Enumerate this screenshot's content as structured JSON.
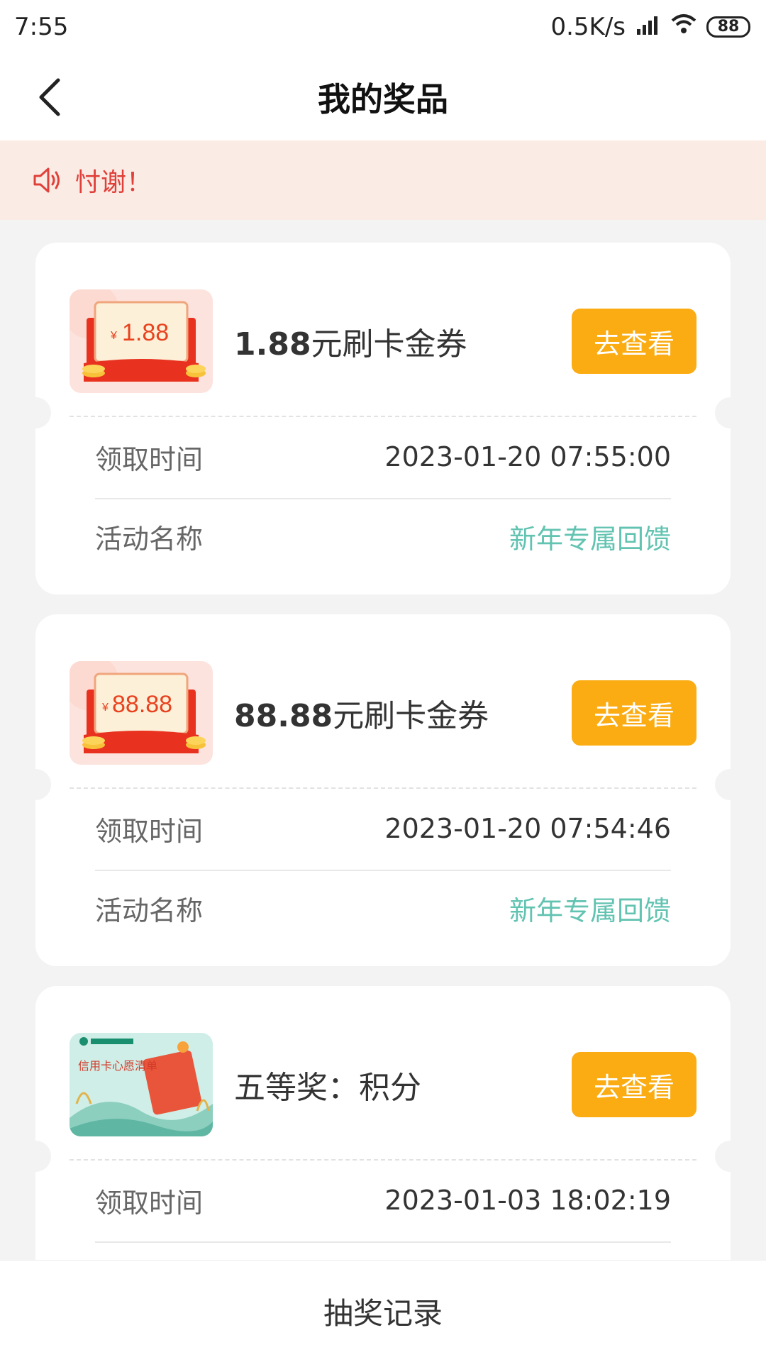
{
  "status_bar": {
    "time": "7:55",
    "net_speed": "0.5K/s",
    "battery": "88",
    "signal_icon": "signal-bars-icon",
    "wifi_icon": "wifi-icon"
  },
  "header": {
    "title": "我的奖品",
    "back_icon": "chevron-left-icon"
  },
  "notice": {
    "icon": "speaker-icon",
    "text": "忖谢！",
    "color": "#e0403a",
    "background": "#fbebe5"
  },
  "colors": {
    "accent_button": "#fbac12",
    "activity_text": "#62c3b1"
  },
  "prizes": [
    {
      "thumb_amount": "1.88",
      "name_amount": "1.88",
      "name_suffix": "元刷卡金券",
      "button_label": "去查看",
      "time_label": "领取时间",
      "time_value": "2023-01-20 07:55:00",
      "activity_label": "活动名称",
      "activity_value": "新年专属回馈"
    },
    {
      "thumb_amount": "88.88",
      "name_amount": "88.88",
      "name_suffix": "元刷卡金券",
      "button_label": "去查看",
      "time_label": "领取时间",
      "time_value": "2023-01-20 07:54:46",
      "activity_label": "活动名称",
      "activity_value": "新年专属回馈"
    },
    {
      "thumb_title": "信用卡心愿清单",
      "name_amount": "",
      "name_suffix": "五等奖：积分",
      "button_label": "去查看",
      "time_label": "领取时间",
      "time_value": "2023-01-03 18:02:19"
    }
  ],
  "bottom": {
    "label": "抽奖记录"
  }
}
